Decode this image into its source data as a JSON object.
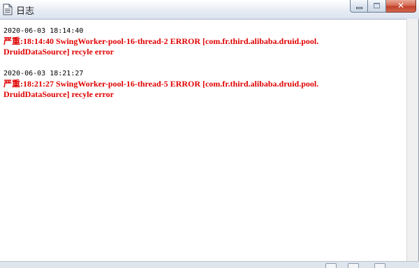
{
  "window": {
    "title": "日志",
    "icon": "document-icon",
    "controls": [
      "minimize-icon",
      "maximize-icon",
      "close-icon"
    ],
    "close_glyph": "✕"
  },
  "log": {
    "entries": [
      {
        "timestamp": "2020-06-03 18:14:40",
        "lines": [
          "严重:18:14:40 SwingWorker-pool-16-thread-2 ERROR [com.fr.third.alibaba.druid.pool.",
          "DruidDataSource] recyle error"
        ]
      },
      {
        "timestamp": "2020-06-03 18:21:27",
        "lines": [
          "严重:18:21:27 SwingWorker-pool-16-thread-5 ERROR [com.fr.third.alibaba.druid.pool.",
          "DruidDataSource] recyle error"
        ]
      }
    ]
  },
  "colors": {
    "error_text": "#e00000",
    "timestamp_text": "#000000"
  }
}
